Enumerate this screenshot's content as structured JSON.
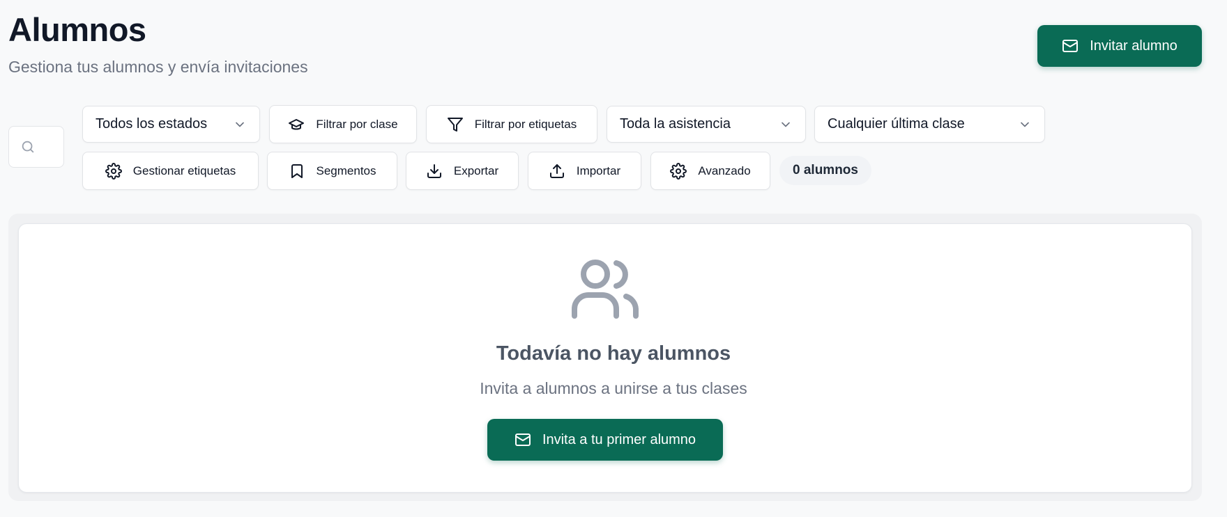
{
  "header": {
    "title": "Alumnos",
    "subtitle": "Gestiona tus alumnos y envía invitaciones",
    "invite_button": {
      "label": "Invitar alumno",
      "icon": "mail-icon"
    }
  },
  "filters": {
    "search": {
      "placeholder": "",
      "icon": "search-icon"
    },
    "status_select": {
      "value": "Todos los estados",
      "icon": "chevron-down-icon"
    },
    "class_filter": {
      "label": "Filtrar por clase",
      "icon": "graduation-cap-icon"
    },
    "tags_filter": {
      "label": "Filtrar por etiquetas",
      "icon": "filter-icon"
    },
    "attendance_select": {
      "value": "Toda la asistencia",
      "icon": "chevron-down-icon"
    },
    "last_class_select": {
      "value": "Cualquier última clase",
      "icon": "chevron-down-icon"
    }
  },
  "actions": {
    "manage_tags": {
      "label": "Gestionar etiquetas",
      "icon": "gear-icon"
    },
    "segments": {
      "label": "Segmentos",
      "icon": "bookmark-icon"
    },
    "export": {
      "label": "Exportar",
      "icon": "download-icon"
    },
    "import": {
      "label": "Importar",
      "icon": "upload-icon"
    },
    "advanced": {
      "label": "Avanzado",
      "icon": "gear-icon"
    },
    "count": "0 alumnos"
  },
  "empty_state": {
    "icon": "users-icon",
    "title": "Todavía no hay alumnos",
    "description": "Invita a alumnos a unirse a tus clases",
    "button": {
      "label": "Invita a tu primer alumno",
      "icon": "mail-icon"
    }
  },
  "colors": {
    "primary": "#0a6b55",
    "background": "#f8f9fa",
    "muted_text": "#6b7280",
    "empty_icon": "#9ca3af"
  }
}
